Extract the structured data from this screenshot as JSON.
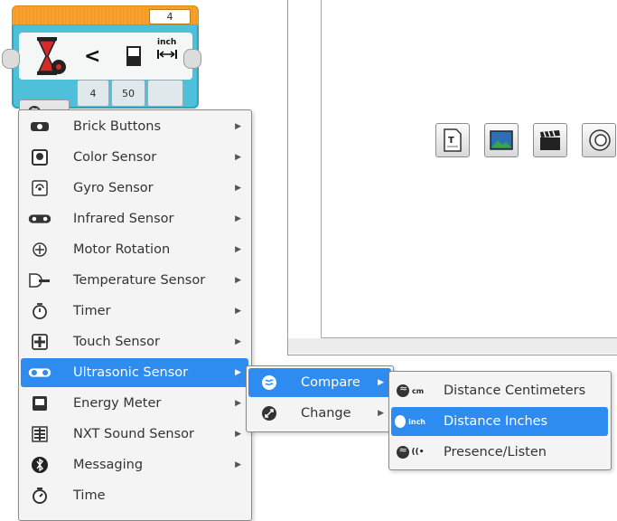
{
  "block": {
    "header_value": "4",
    "unit_label": "inch",
    "compare_symbol": "<",
    "port_values": [
      "4",
      "50"
    ],
    "mode_label": "inch"
  },
  "main_menu": [
    {
      "label": "Brick Buttons",
      "icon": "brick-buttons-icon",
      "has_submenu": true
    },
    {
      "label": "Color Sensor",
      "icon": "color-sensor-icon",
      "has_submenu": true
    },
    {
      "label": "Gyro Sensor",
      "icon": "gyro-sensor-icon",
      "has_submenu": true
    },
    {
      "label": "Infrared Sensor",
      "icon": "infrared-sensor-icon",
      "has_submenu": true
    },
    {
      "label": "Motor Rotation",
      "icon": "motor-rotation-icon",
      "has_submenu": true
    },
    {
      "label": "Temperature Sensor",
      "icon": "temperature-sensor-icon",
      "has_submenu": true
    },
    {
      "label": "Timer",
      "icon": "timer-icon",
      "has_submenu": true
    },
    {
      "label": "Touch Sensor",
      "icon": "touch-sensor-icon",
      "has_submenu": true
    },
    {
      "label": "Ultrasonic Sensor",
      "icon": "ultrasonic-sensor-icon",
      "has_submenu": true,
      "selected": true
    },
    {
      "label": "Energy Meter",
      "icon": "energy-meter-icon",
      "has_submenu": true
    },
    {
      "label": "NXT Sound Sensor",
      "icon": "nxt-sound-sensor-icon",
      "has_submenu": true
    },
    {
      "label": "Messaging",
      "icon": "messaging-icon",
      "has_submenu": true
    },
    {
      "label": "Time",
      "icon": "time-icon",
      "has_submenu": false
    }
  ],
  "sub_menu": [
    {
      "label": "Compare",
      "selected": true
    },
    {
      "label": "Change",
      "selected": false
    }
  ],
  "compare_menu": [
    {
      "label": "Distance Centimeters",
      "badge": "cm",
      "selected": false
    },
    {
      "label": "Distance Inches",
      "badge": "inch",
      "selected": true
    },
    {
      "label": "Presence/Listen",
      "badge": "((•",
      "selected": false
    }
  ],
  "colors": {
    "selection": "#2e8bef",
    "block_body": "#4ec0d9",
    "block_header": "#f39a21"
  }
}
